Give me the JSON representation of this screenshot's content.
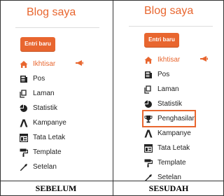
{
  "before": {
    "title": "Blog saya",
    "new_entry_label": "Entri baru",
    "menu": [
      {
        "label": "Ikhtisar",
        "icon": "home-icon",
        "active": true
      },
      {
        "label": "Pos",
        "icon": "posts-icon"
      },
      {
        "label": "Laman",
        "icon": "pages-icon"
      },
      {
        "label": "Statistik",
        "icon": "pie-chart-icon"
      },
      {
        "label": "Kampanye",
        "icon": "campaign-icon"
      },
      {
        "label": "Tata Letak",
        "icon": "layout-icon"
      },
      {
        "label": "Template",
        "icon": "paint-roller-icon"
      },
      {
        "label": "Setelan",
        "icon": "wrench-icon"
      }
    ],
    "caption": "SEBELUM"
  },
  "after": {
    "title": "Blog saya",
    "new_entry_label": "Entri baru",
    "menu": [
      {
        "label": "Ikhtisar",
        "icon": "home-icon",
        "active": true
      },
      {
        "label": "Pos",
        "icon": "posts-icon"
      },
      {
        "label": "Laman",
        "icon": "pages-icon"
      },
      {
        "label": "Statistik",
        "icon": "pie-chart-icon"
      },
      {
        "label": "Penghasilan",
        "icon": "trophy-icon",
        "highlighted": true
      },
      {
        "label": "Kampanye",
        "icon": "campaign-icon"
      },
      {
        "label": "Tata Letak",
        "icon": "layout-icon"
      },
      {
        "label": "Template",
        "icon": "paint-roller-icon"
      },
      {
        "label": "Setelan",
        "icon": "wrench-icon"
      }
    ],
    "caption": "SESUDAH"
  },
  "colors": {
    "accent": "#e8662f",
    "text": "#222222",
    "border": "#333333"
  }
}
